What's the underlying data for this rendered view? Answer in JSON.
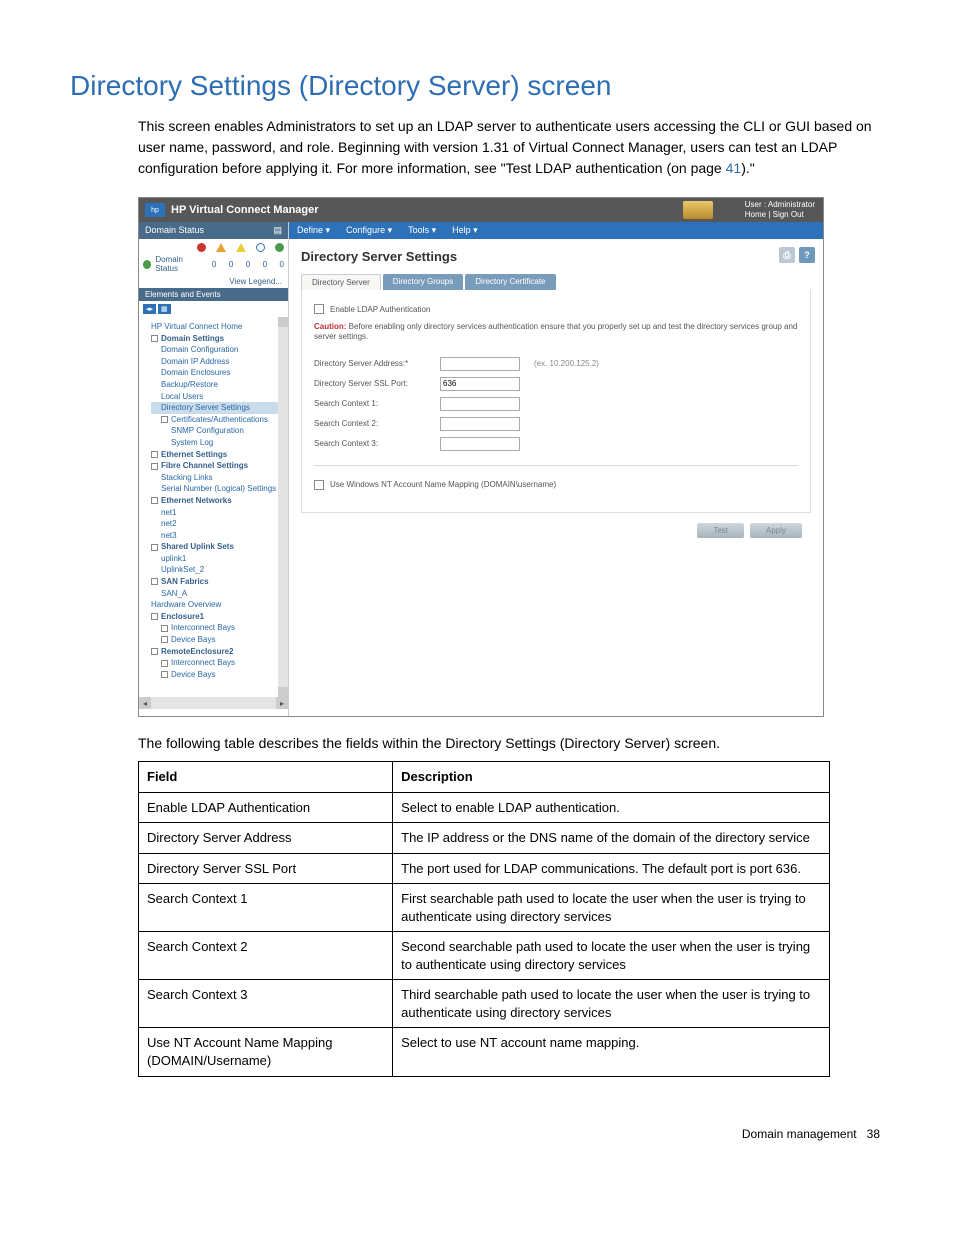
{
  "page": {
    "title": "Directory Settings (Directory Server) screen",
    "intro_pre": "This screen enables Administrators to set up an LDAP server to authenticate users accessing the CLI or GUI based on user name, password, and role. Beginning with version 1.31 of Virtual Connect Manager, users can test an LDAP configuration before applying it. For more information, see \"Test LDAP authentication (on page ",
    "intro_link": "41",
    "intro_post": ").\"",
    "after_shot": "The following table describes the fields within the Directory Settings (Directory Server) screen.",
    "footer_section": "Domain management",
    "footer_page": "38"
  },
  "screenshot": {
    "app_title": "HP Virtual Connect Manager",
    "user_line": "User : Administrator",
    "user_links": "Home | Sign Out",
    "left": {
      "domain_status": "Domain Status",
      "status_label": "Domain Status",
      "counts": [
        "0",
        "0",
        "0",
        "0",
        "0"
      ],
      "view_legend": "View Legend...",
      "elements_events": "Elements and Events",
      "tree": [
        {
          "t": "HP Virtual Connect Home",
          "cls": ""
        },
        {
          "t": "Domain Settings",
          "cls": "bold",
          "sq": true
        },
        {
          "t": "Domain Configuration",
          "cls": "ind1"
        },
        {
          "t": "Domain IP Address",
          "cls": "ind1"
        },
        {
          "t": "Domain Enclosures",
          "cls": "ind1"
        },
        {
          "t": "Backup/Restore",
          "cls": "ind1"
        },
        {
          "t": "Local Users",
          "cls": "ind1"
        },
        {
          "t": "Directory Server Settings",
          "cls": "ind1 sel"
        },
        {
          "t": "Certificates/Authentications",
          "cls": "ind1",
          "sq": true
        },
        {
          "t": "SNMP Configuration",
          "cls": "ind2"
        },
        {
          "t": "System Log",
          "cls": "ind2"
        },
        {
          "t": "Ethernet Settings",
          "cls": "bold",
          "sq": true
        },
        {
          "t": "Fibre Channel Settings",
          "cls": "bold",
          "sq": true
        },
        {
          "t": "Stacking Links",
          "cls": "ind1"
        },
        {
          "t": "Serial Number (Logical) Settings",
          "cls": "ind1"
        },
        {
          "t": "Ethernet Networks",
          "cls": "bold",
          "sq": true
        },
        {
          "t": "net1",
          "cls": "ind1"
        },
        {
          "t": "net2",
          "cls": "ind1"
        },
        {
          "t": "net3",
          "cls": "ind1"
        },
        {
          "t": "Shared Uplink Sets",
          "cls": "bold",
          "sq": true
        },
        {
          "t": "uplink1",
          "cls": "ind1"
        },
        {
          "t": "UplinkSet_2",
          "cls": "ind1"
        },
        {
          "t": "SAN Fabrics",
          "cls": "bold",
          "sq": true
        },
        {
          "t": "SAN_A",
          "cls": "ind1"
        },
        {
          "t": "Hardware Overview",
          "cls": ""
        },
        {
          "t": "Enclosure1",
          "cls": "bold",
          "sq": true
        },
        {
          "t": "Interconnect Bays",
          "cls": "ind1",
          "sq": true
        },
        {
          "t": "Device Bays",
          "cls": "ind1",
          "sq": true
        },
        {
          "t": "RemoteEnclosure2",
          "cls": "bold",
          "sq": true
        },
        {
          "t": "Interconnect Bays",
          "cls": "ind1",
          "sq": true
        },
        {
          "t": "Device Bays",
          "cls": "ind1",
          "sq": true
        }
      ]
    },
    "menubar": [
      "Define ▾",
      "Configure ▾",
      "Tools ▾",
      "Help ▾"
    ],
    "main_heading": "Directory Server Settings",
    "tabs": [
      "Directory Server",
      "Directory Groups",
      "Directory Certificate"
    ],
    "form": {
      "enable_label": "Enable LDAP Authentication",
      "caution_bold": "Caution:",
      "caution_text": " Before enabling only directory services authentication ensure that you properly set up and test the directory services group and server settings.",
      "rows": [
        {
          "label": "Directory Server Address:*",
          "value": "",
          "hint": "(ex. 10.200.125.2)"
        },
        {
          "label": "Directory Server SSL Port:",
          "value": "636",
          "hint": ""
        },
        {
          "label": "Search Context 1:",
          "value": "",
          "hint": ""
        },
        {
          "label": "Search Context 2:",
          "value": "",
          "hint": ""
        },
        {
          "label": "Search Context 3:",
          "value": "",
          "hint": ""
        }
      ],
      "nt_label": "Use Windows NT Account Name Mapping (DOMAIN\\username)",
      "btn_test": "Test",
      "btn_apply": "Apply"
    }
  },
  "table": {
    "head": [
      "Field",
      "Description"
    ],
    "rows": [
      [
        "Enable LDAP Authentication",
        "Select to enable LDAP authentication."
      ],
      [
        "Directory Server Address",
        "The IP address or the DNS name of the domain of the directory service"
      ],
      [
        "Directory Server SSL Port",
        "The port used for LDAP communications. The default port is port 636."
      ],
      [
        "Search Context 1",
        "First searchable path used to locate the user when the user is trying to authenticate using directory services"
      ],
      [
        "Search Context 2",
        "Second searchable path used to locate the user when the user is trying to authenticate using directory services"
      ],
      [
        "Search Context 3",
        "Third searchable path used to locate the user when the user is trying to authenticate using directory services"
      ],
      [
        "Use NT Account Name Mapping (DOMAIN/Username)",
        "Select to use NT account name mapping."
      ]
    ]
  }
}
